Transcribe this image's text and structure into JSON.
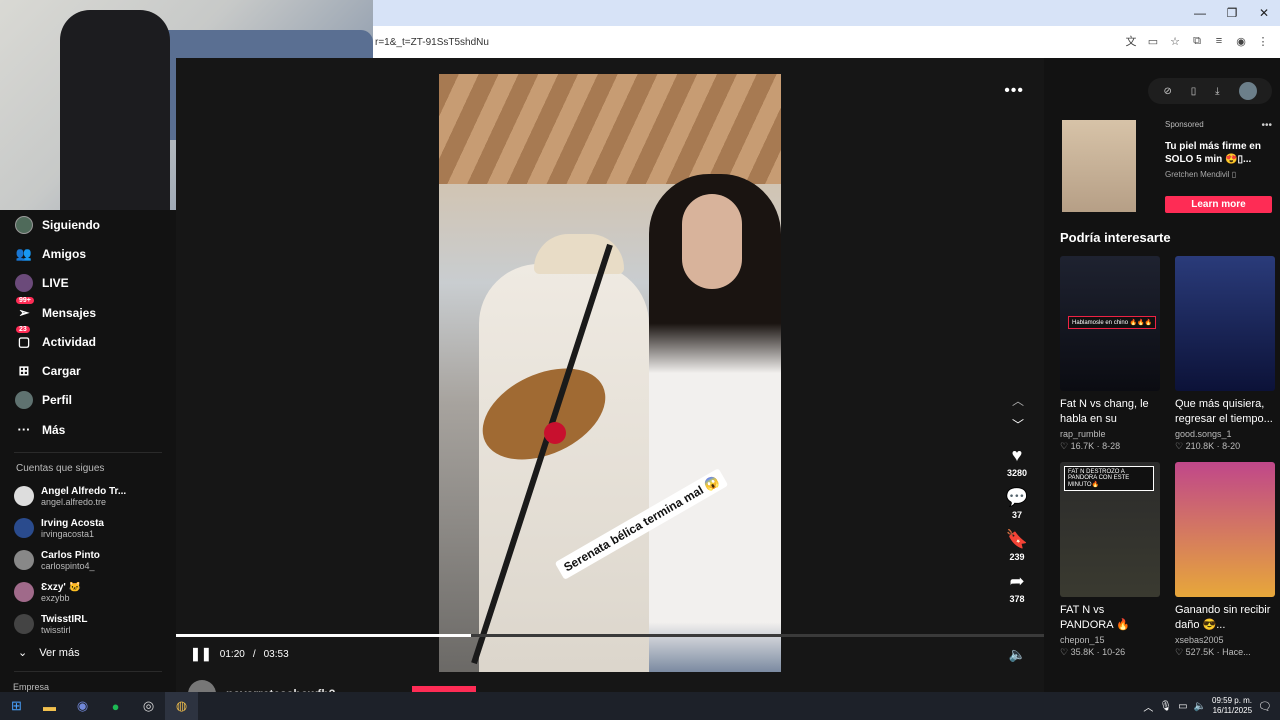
{
  "browser": {
    "url_partial": "r=1&_t=ZT-91SsT5shdNu",
    "window_controls": {
      "minimize": "—",
      "restore": "❐",
      "close": "✕"
    }
  },
  "sidebar": {
    "items": [
      {
        "label": "Siguiendo",
        "icon": "following-avatar-icon"
      },
      {
        "label": "Amigos",
        "icon": "friends-icon"
      },
      {
        "label": "LIVE",
        "icon": "live-icon"
      },
      {
        "label": "Mensajes",
        "icon": "messages-icon",
        "badge": "99+"
      },
      {
        "label": "Actividad",
        "icon": "activity-icon",
        "badge": "23"
      },
      {
        "label": "Cargar",
        "icon": "upload-icon"
      },
      {
        "label": "Perfil",
        "icon": "profile-avatar-icon"
      },
      {
        "label": "Más",
        "icon": "more-icon"
      }
    ],
    "following_title": "Cuentas que sigues",
    "accounts": [
      {
        "name": "Angel Alfredo Tr...",
        "id": "angel.alfredo.tre"
      },
      {
        "name": "Irving Acosta",
        "id": "irvingacosta1"
      },
      {
        "name": "Carlos Pinto",
        "id": "carlospinto4_"
      },
      {
        "name": "Ɛxzy' 🐱",
        "id": "exzybb"
      },
      {
        "name": "TwisstIRL",
        "id": "twisstirl"
      }
    ],
    "see_more": "Ver más",
    "footer": "Empresa"
  },
  "video": {
    "caption": "Serenata bélica termina mal 😱",
    "time_current": "01:20",
    "time_total": "03:53",
    "progress": 0.34,
    "likes": "3280",
    "comments": "37",
    "saves": "239",
    "shares": "378",
    "author": "navarretesshowfb3"
  },
  "right": {
    "ad": {
      "sponsored": "Sponsored",
      "title": "Tu piel más firme en SOLO 5 min 😍▯...",
      "author": "Gretchen Mendivil ▯",
      "cta": "Learn more"
    },
    "section_title": "Podría interesarte",
    "cards": [
      {
        "title": "Fat N vs chang, le habla en su odioma...",
        "user": "rap_rumble",
        "likes": "16.7K",
        "date": "8-28",
        "overlay": "Hablamosle en chino 🔥🔥🔥",
        "color1": "#1e2230",
        "color2": "#0b0c12"
      },
      {
        "title": "Que más quisiera, regresar el tiempo...",
        "user": "good.songs_1",
        "likes": "210.8K",
        "date": "8-20",
        "overlay": "",
        "color1": "#2a3b7a",
        "color2": "#0c1238"
      },
      {
        "title": "FAT N vs PANDORA 🔥 #fatn...",
        "user": "chepon_15",
        "likes": "35.8K",
        "date": "10-26",
        "overlay": "FAT N DESTROZO A PANDORA CON ESTE MINUTO🔥",
        "color1": "#2b2b2b",
        "color2": "#3a3a30"
      },
      {
        "title": "Ganando sin recibir daño 😎...",
        "user": "xsebas2005",
        "likes": "527.5K",
        "date": "Hace...",
        "overlay": "",
        "color1": "#c0478a",
        "color2": "#e7a73a"
      }
    ]
  },
  "taskbar": {
    "time": "09:59 p. m.",
    "date": "16/11/2025"
  }
}
